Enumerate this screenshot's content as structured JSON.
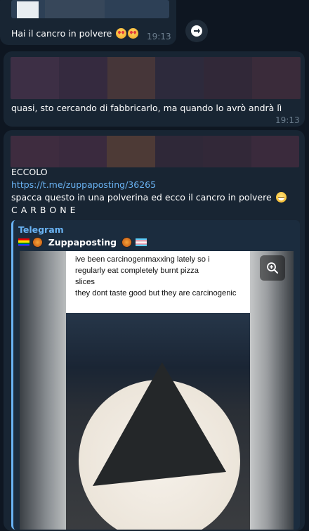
{
  "msg1": {
    "text": "Hai il cancro in polvere",
    "time": "19:13",
    "emojis": [
      "heart-eyes",
      "heart-eyes"
    ]
  },
  "msg2": {
    "text": "quasi, sto cercando di fabbricarlo, ma quando lo avrò andrà lì",
    "time": "19:13"
  },
  "msg3": {
    "line1": "ECCOLO",
    "link": "https://t.me/zuppaposting/36265",
    "line3": "spacca questo in una polverina ed ecco il cancro in polvere",
    "line4": "C A R B O N E",
    "emoji": "grinning-face"
  },
  "preview": {
    "site": "Telegram",
    "channel": "Zuppaposting",
    "meme_lines": [
      "ive been carcinogenmaxxing lately so i",
      "regularly eat completely burnt pizza",
      "slices",
      "they dont taste good but they are carcinogenic"
    ]
  },
  "colors": {
    "background": "#0e1621",
    "bubble": "#182533",
    "link": "#6ab3f3",
    "time": "#6d7f8f"
  },
  "icons": [
    "share-icon",
    "zoom-icon",
    "rainbow-flag-icon",
    "trans-flag-icon",
    "pizza-icon"
  ]
}
